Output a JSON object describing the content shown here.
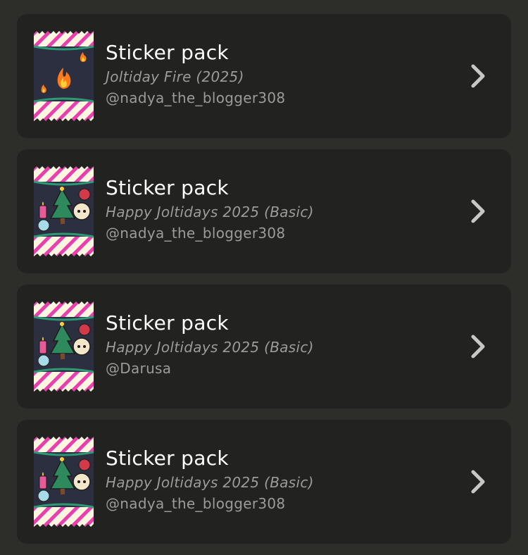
{
  "packs": [
    {
      "title": "Sticker pack",
      "name": "Joltiday Fire (2025)",
      "author": "@nadya_the_blogger308",
      "art": "fire-pack-icon"
    },
    {
      "title": "Sticker pack",
      "name": "Happy Joltidays 2025 (Basic)",
      "author": "@nadya_the_blogger308",
      "art": "holiday-pack-icon"
    },
    {
      "title": "Sticker pack",
      "name": "Happy Joltidays 2025 (Basic)",
      "author": "@Darusa",
      "art": "holiday-pack-icon"
    },
    {
      "title": "Sticker pack",
      "name": "Happy Joltidays 2025 (Basic)",
      "author": "@nadya_the_blogger308",
      "art": "holiday-pack-icon"
    }
  ],
  "colors": {
    "background": "#2d2e2a",
    "card": "#222320",
    "title": "#ffffff",
    "secondary": "#9b9b98",
    "stripe": "#e83fae",
    "pack_base": "#fff6e0",
    "chevron": "#c7c7c5"
  }
}
